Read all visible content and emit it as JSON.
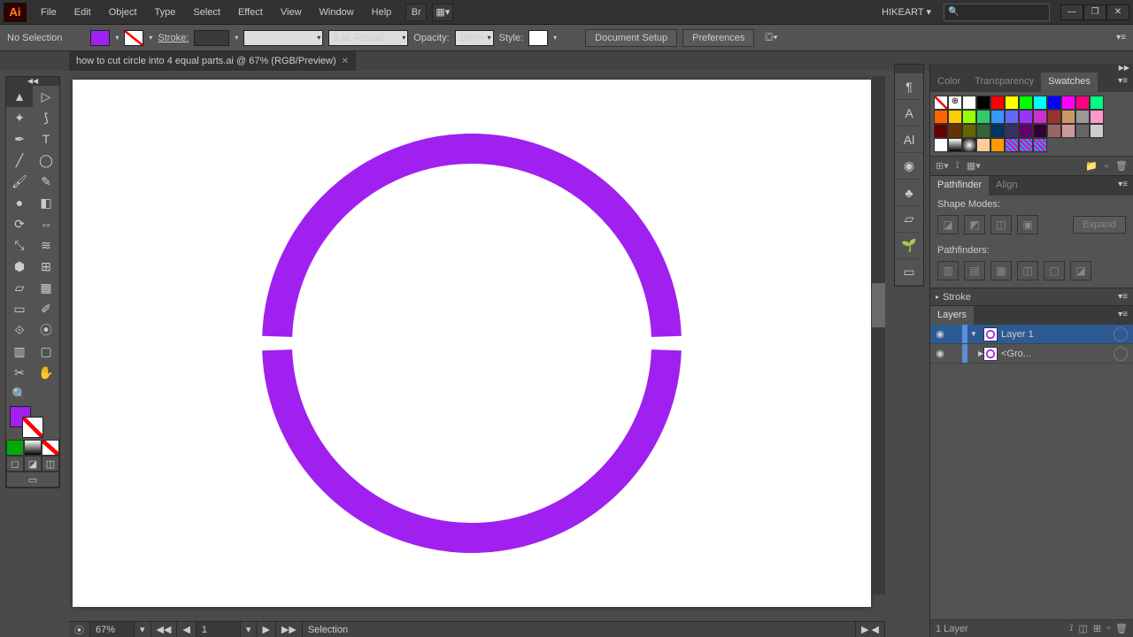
{
  "app": {
    "logo": "Ai"
  },
  "menu": [
    "File",
    "Edit",
    "Object",
    "Type",
    "Select",
    "Effect",
    "View",
    "Window",
    "Help"
  ],
  "user": "HIKEART",
  "window_controls": [
    "—",
    "❐",
    "✕"
  ],
  "ctrlbar": {
    "selection": "No Selection",
    "stroke_label": "Stroke:",
    "stroke_weight": "",
    "brush_label": "3 pt. Round",
    "opacity_label": "Opacity:",
    "opacity_value": "100%",
    "style_label": "Style:",
    "doc_setup": "Document Setup",
    "prefs": "Preferences"
  },
  "doc_tab": "how to cut circle into 4 equal parts.ai @ 67% (RGB/Preview)",
  "statusbar": {
    "zoom": "67%",
    "page": "1",
    "tool": "Selection"
  },
  "panels": {
    "swatches_tabs": [
      "Color",
      "Transparency",
      "Swatches"
    ],
    "pathfinder_tabs": [
      "Pathfinder",
      "Align"
    ],
    "shape_modes": "Shape Modes:",
    "pathfinders": "Pathfinders:",
    "expand": "Expand",
    "stroke": "Stroke",
    "layers": "Layers",
    "layer_items": [
      "Layer 1",
      "<Gro..."
    ],
    "layers_count": "1 Layer"
  },
  "swatch_colors": [
    "none",
    "reg",
    "#ffffff",
    "#000000",
    "#ff0000",
    "#ffff00",
    "#00ff00",
    "#00ffff",
    "#0000ff",
    "#ff00ff",
    "#ff0080",
    "#00ff80",
    "#ff6600",
    "#ffcc00",
    "#99ff00",
    "#33cc66",
    "#3399ff",
    "#6666ff",
    "#9933ff",
    "#cc33cc",
    "#993333",
    "#cc9966",
    "#999999",
    "#ff99cc",
    "#660000",
    "#663300",
    "#666600",
    "#336633",
    "#003366",
    "#333366",
    "#660066",
    "#330033",
    "#996666",
    "#cc9999",
    "#666666",
    "#cccccc",
    "#ffffff",
    "grad1",
    "grad2",
    "#ffcc99",
    "#ff9900",
    "conf1",
    "conf2",
    "conf3"
  ]
}
